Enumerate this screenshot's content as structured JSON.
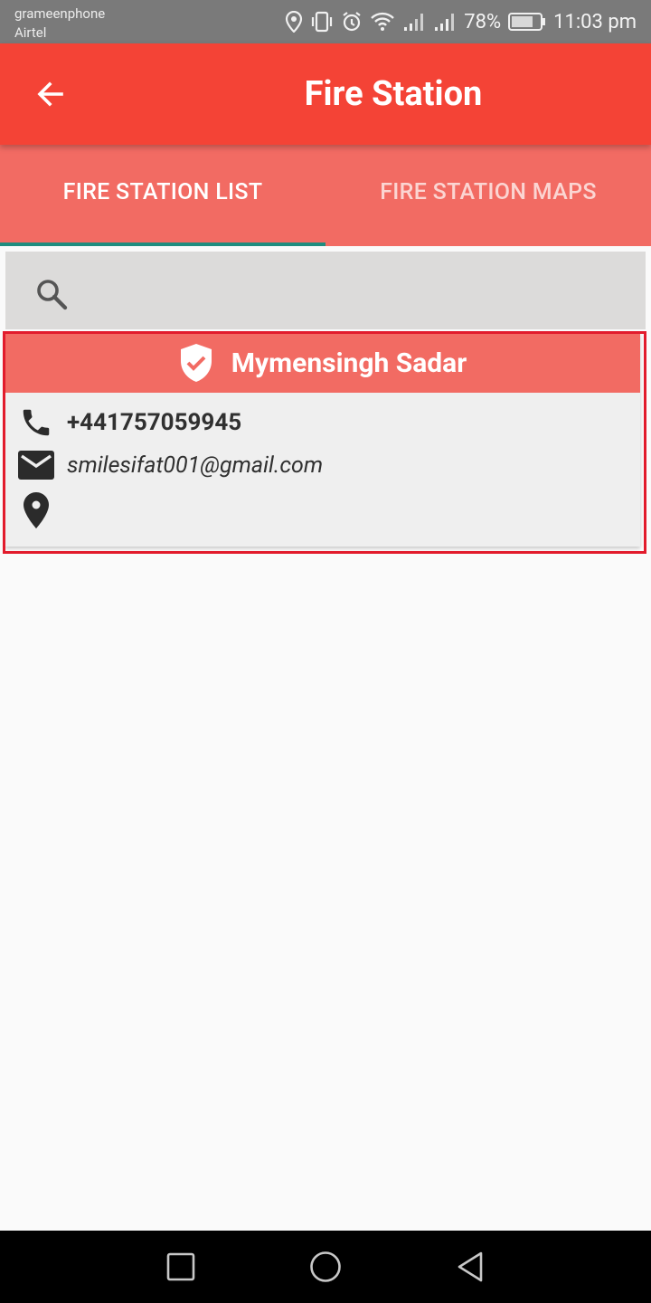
{
  "status_bar": {
    "carrier_1": "grameenphone",
    "carrier_2": "Airtel",
    "battery": "78%",
    "time": "11:03 pm",
    "icons": [
      "location-icon",
      "vibrate-icon",
      "alarm-icon",
      "wifi-icon",
      "signal-icon",
      "signal-icon",
      "battery-icon"
    ]
  },
  "app_bar": {
    "title": "Fire Station",
    "back_icon": "arrow-back-icon",
    "color": "#f44336"
  },
  "tabs": [
    {
      "label": "FIRE STATION LIST",
      "selected": true
    },
    {
      "label": "FIRE STATION MAPS",
      "selected": false
    }
  ],
  "search": {
    "icon": "search-icon",
    "value": ""
  },
  "stations": [
    {
      "name": "Mymensingh Sadar",
      "phone": "+441757059945",
      "email": "smilesifat001@gmail.com",
      "address": ""
    }
  ],
  "colors": {
    "accent": "#f26b63",
    "tab_indicator": "#1f8c7e",
    "highlight": "#e21b2c"
  },
  "nav_bar": {
    "buttons": [
      "recents-square-icon",
      "home-circle-icon",
      "back-triangle-icon"
    ]
  }
}
